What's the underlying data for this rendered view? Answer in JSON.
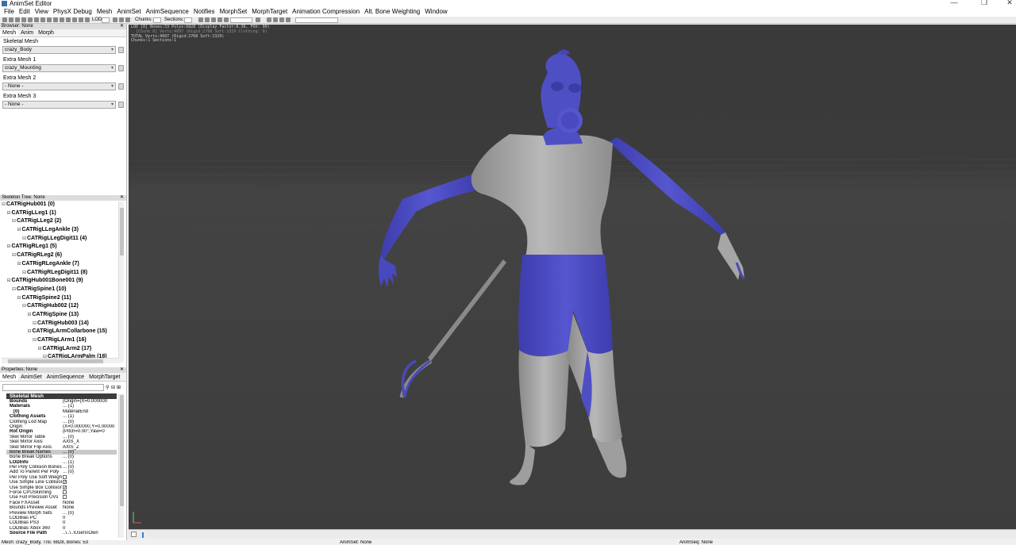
{
  "window": {
    "title": "AnimSet Editor",
    "minimize": "—",
    "maximize": "❐",
    "close": "✕"
  },
  "menu": [
    "File",
    "Edit",
    "View",
    "PhysX Debug",
    "Mesh",
    "AnimSet",
    "AnimSequence",
    "Notifies",
    "MorphSet",
    "MorphTarget",
    "Animation Compression",
    "Alt. Bone Weighting",
    "Window"
  ],
  "toolbar": {
    "lod_label": "LOD",
    "chunks_label": "Chunks:",
    "sections_label": "Sections:"
  },
  "browser": {
    "header": "Browser: None",
    "tabs": [
      "Mesh",
      "Anim",
      "Morph"
    ],
    "rows": [
      {
        "label": "Skeletal Mesh",
        "value": "crazy_Body"
      },
      {
        "label": "Extra Mesh 1",
        "value": "crazy_Mounting"
      },
      {
        "label": "Extra Mesh 2",
        "value": "- None -"
      },
      {
        "label": "Extra Mesh 3",
        "value": "- None -"
      }
    ]
  },
  "skeleton": {
    "header": "Skeleton Tree: None",
    "nodes": [
      {
        "label": "CATRigHub001 (0)",
        "depth": 0
      },
      {
        "label": "CATRigLLeg1 (1)",
        "depth": 1
      },
      {
        "label": "CATRigLLeg2 (2)",
        "depth": 2
      },
      {
        "label": "CATRigLLegAnkle (3)",
        "depth": 3
      },
      {
        "label": "CATRigLLegDigit11 (4)",
        "depth": 4
      },
      {
        "label": "CATRigRLeg1 (5)",
        "depth": 1
      },
      {
        "label": "CATRigRLeg2 (6)",
        "depth": 2
      },
      {
        "label": "CATRigRLegAnkle (7)",
        "depth": 3
      },
      {
        "label": "CATRigRLegDigit11 (8)",
        "depth": 4
      },
      {
        "label": "CATRigHub001Bone001 (9)",
        "depth": 1
      },
      {
        "label": "CATRigSpine1 (10)",
        "depth": 2
      },
      {
        "label": "CATRigSpine2 (11)",
        "depth": 3
      },
      {
        "label": "CATRigHub002 (12)",
        "depth": 4
      },
      {
        "label": "CATRigSpine (13)",
        "depth": 5
      },
      {
        "label": "CATRigHub003 (14)",
        "depth": 6
      },
      {
        "label": "CATRigLArmCollarbone (15)",
        "depth": 5
      },
      {
        "label": "CATRigLArm1 (16)",
        "depth": 6
      },
      {
        "label": "CATRigLArm2 (17)",
        "depth": 7
      },
      {
        "label": "CATRigLArmPalm (18)",
        "depth": 8
      }
    ]
  },
  "properties": {
    "header": "Properties: None",
    "tabs": [
      "Mesh",
      "AnimSet",
      "AnimSequence",
      "MorphTarget"
    ],
    "category": "Skeletal Mesh",
    "rows": [
      {
        "name": "Bounds",
        "value": "(Origin=(X=0.000000",
        "bold": true,
        "level": 0
      },
      {
        "name": "Materials",
        "value": "... (1)",
        "bold": true,
        "level": 0
      },
      {
        "name": "[0]",
        "value": "MaterialEnd",
        "bold": true,
        "level": 1
      },
      {
        "name": "Clothing Assets",
        "value": "... (1)",
        "bold": true,
        "level": 0
      },
      {
        "name": "Clothing Lod Map",
        "value": "... (0)",
        "bold": false,
        "level": 0
      },
      {
        "name": "Origin",
        "value": "(X=0.000000,Y=0.00000",
        "bold": false,
        "level": 0
      },
      {
        "name": "Rot Origin",
        "value": "(Pitch=0.00°,Yaw=0",
        "bold": true,
        "level": 0
      },
      {
        "name": "Skel Mirror Table",
        "value": "... (0)",
        "bold": false,
        "level": 0
      },
      {
        "name": "Skel Mirror Axis",
        "value": "AXIS_X",
        "bold": false,
        "level": 0
      },
      {
        "name": "Skel Mirror Flip Axis",
        "value": "AXIS_Z",
        "bold": false,
        "level": 0
      },
      {
        "name": "Bone Break Names",
        "value": "... (0)",
        "bold": false,
        "level": 0,
        "hl": true
      },
      {
        "name": "Bone Break Options",
        "value": "... (0)",
        "bold": false,
        "level": 0
      },
      {
        "name": "LODInfo",
        "value": "... (1)",
        "bold": true,
        "level": 0
      },
      {
        "name": "Per Poly Collision Bones",
        "value": "... (0)",
        "bold": false,
        "level": 0
      },
      {
        "name": "Add To Parent Per Poly",
        "value": "... (0)",
        "bold": false,
        "level": 0
      },
      {
        "name": "Per Poly Use Soft Weight",
        "value": "",
        "check": true,
        "level": 0
      },
      {
        "name": "Use Simple Line Collision",
        "value": "",
        "check": true,
        "checked": true,
        "level": 0
      },
      {
        "name": "Use Simple Box Collision",
        "value": "",
        "check": true,
        "checked": true,
        "level": 0
      },
      {
        "name": "Force CPUSkinning",
        "value": "",
        "check": true,
        "level": 0
      },
      {
        "name": "Use Full Precision UVs",
        "value": "",
        "check": true,
        "level": 0
      },
      {
        "name": "Face FXAsset",
        "value": "None",
        "bold": false,
        "level": 0
      },
      {
        "name": "Bounds Preview Asset",
        "value": "None",
        "bold": false,
        "level": 0
      },
      {
        "name": "Preview Morph Sets",
        "value": "... (0)",
        "bold": false,
        "level": 0
      },
      {
        "name": "LODBias PC",
        "value": "0",
        "bold": false,
        "level": 0
      },
      {
        "name": "LODBias PS3",
        "value": "0",
        "bold": false,
        "level": 0
      },
      {
        "name": "LODBias Xbox 360",
        "value": "0",
        "bold": false,
        "level": 0
      },
      {
        "name": "Source File Path",
        "value": "..\\..\\..\\Users\\Own",
        "bold": true,
        "level": 0
      }
    ]
  },
  "viewport": {
    "stats": [
      "LOD [0] Bones:53 Polys:6828 (Display Factor:6.36, FOV: 90)",
      "  [Chunk 0] Verts:4097 (Rigid:2768 Soft:1329 Clothing: 0)",
      "TOTAL Verts:4097 (Rigid:2768 Soft:1329)",
      "Chunks:1 Sections:1"
    ]
  },
  "status": {
    "mesh": "Mesh: crazy_Body, Tris: 6828, Bones: 53",
    "animset": "AnimSet: None",
    "animseq": "AnimSeq: None"
  },
  "colors": {
    "viewport_bg": "#3a3a3a",
    "mesh_blue": "#4f4fc4",
    "mesh_grey": "#a3a3a3"
  }
}
